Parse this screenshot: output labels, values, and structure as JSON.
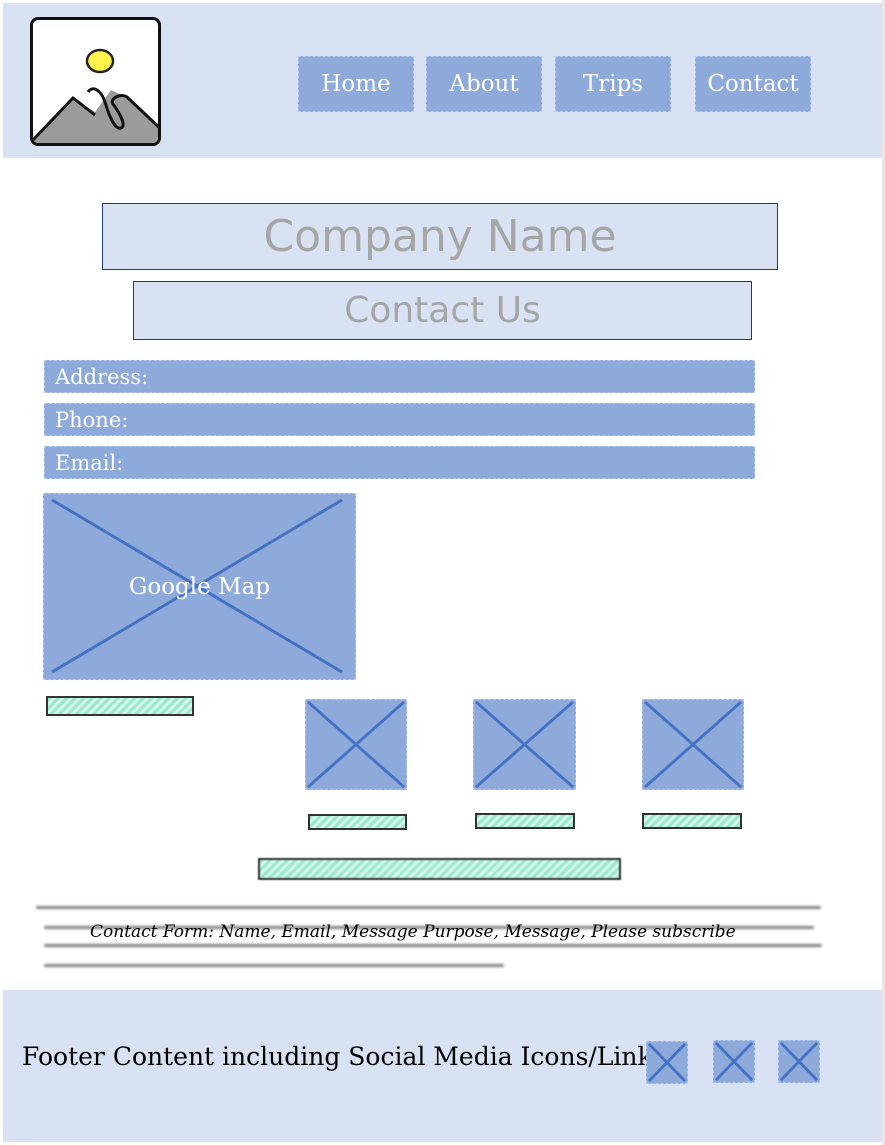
{
  "nav": {
    "items": [
      "Home",
      "About",
      "Trips",
      "Contact"
    ]
  },
  "hero": {
    "company_name": "Company Name",
    "page_heading": "Contact Us"
  },
  "contact_info": {
    "address_label": "Address:",
    "phone_label": "Phone:",
    "email_label": "Email:"
  },
  "map": {
    "label": "Google Map"
  },
  "contact_form": {
    "text": "Contact Form:  Name, Email, Message Purpose, Message, Please subscribe"
  },
  "footer": {
    "text": "Footer Content including Social Media Icons/Links"
  },
  "colors": {
    "header_bg": "#d9e2f3",
    "button_bg": "#8eaadb",
    "x_stroke": "#4472c4",
    "hatch_green": "#9be8d0"
  }
}
